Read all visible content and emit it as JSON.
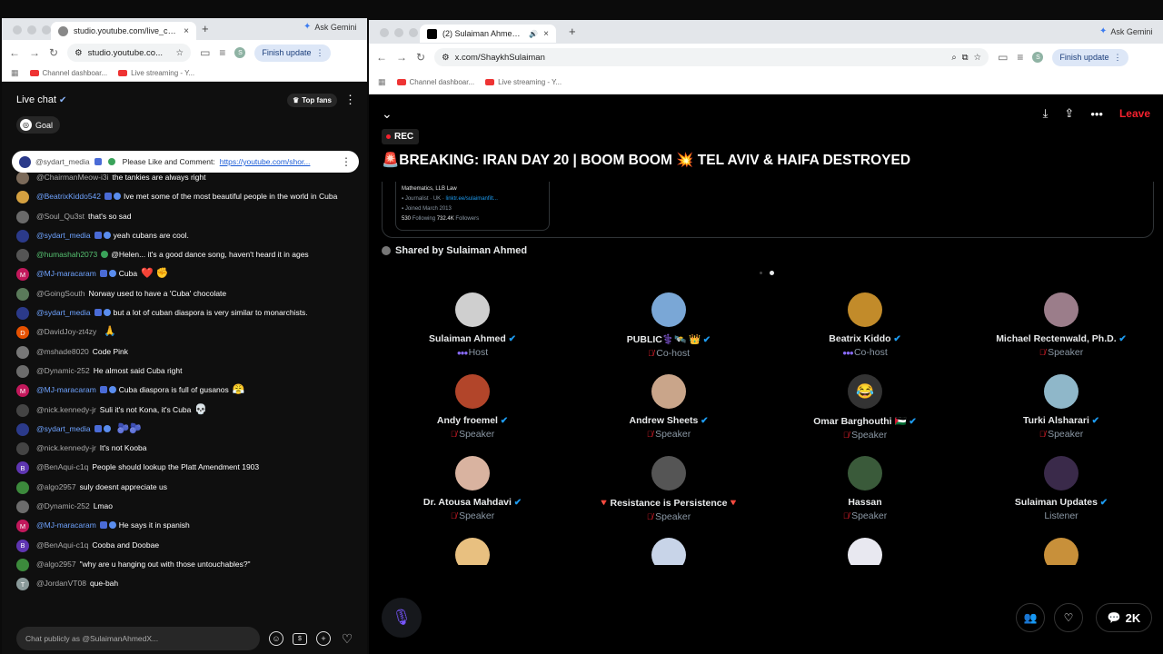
{
  "left_browser": {
    "tab_title": "studio.youtube.com/live_chat",
    "tab_close": "×",
    "new_tab": "+",
    "gemini": "Ask Gemini",
    "url": "studio.youtube.co...",
    "profile": "S",
    "finish_update": "Finish update",
    "bookmarks": [
      "Channel dashboar...",
      "Live streaming - Y..."
    ]
  },
  "right_browser": {
    "tab_title": "(2) Sulaiman Ahmed (@S",
    "tab_close": "×",
    "new_tab": "+",
    "gemini": "Ask Gemini",
    "url": "x.com/ShaykhSulaiman",
    "profile": "S",
    "finish_update": "Finish update",
    "bookmarks": [
      "Channel dashboar...",
      "Live streaming - Y..."
    ]
  },
  "chat": {
    "title": "Live chat",
    "top_fans": "Top fans",
    "goal": "Goal",
    "pinned": {
      "user": "@sydart_media",
      "text": "Please Like and Comment:",
      "link": "https://youtube.com/shor..."
    },
    "placeholder": "Chat publicly as @SulaimanAhmedX...",
    "messages": [
      {
        "user": "@ChairmanMeow-i3i",
        "text": "the tankies are always right",
        "color": "#7b6a5a",
        "kind": "plain",
        "initial": ""
      },
      {
        "user": "@BeatrixKiddo542",
        "text": "Ive met some of the most beautiful people in the world in Cuba",
        "color": "#d4a040",
        "kind": "member",
        "initial": ""
      },
      {
        "user": "@Soul_Qu3st",
        "text": "that's so sad",
        "color": "#6a6a6a",
        "kind": "plain",
        "initial": ""
      },
      {
        "user": "@sydart_media",
        "text": "yeah cubans are cool.",
        "color": "#2b3a8a",
        "kind": "member",
        "initial": ""
      },
      {
        "user": "@humashah2073",
        "text": "@Helen... it's a good dance song, haven't heard it in ages",
        "color": "#555",
        "kind": "green",
        "initial": ""
      },
      {
        "user": "@MJ-maracaram",
        "text": "Cuba",
        "color": "#c2185b",
        "kind": "member",
        "initial": "M",
        "emoji": "❤️ ✊"
      },
      {
        "user": "@GoingSouth",
        "text": "Norway used to have a 'Cuba' chocolate",
        "color": "#5a7a5a",
        "kind": "plain",
        "initial": ""
      },
      {
        "user": "@sydart_media",
        "text": "but a lot of cuban diaspora is very similar to monarchists.",
        "color": "#2b3a8a",
        "kind": "member",
        "initial": ""
      },
      {
        "user": "@DavidJoy-zt4zy",
        "text": "",
        "color": "#e65100",
        "kind": "plain",
        "initial": "D",
        "emoji": "🙏"
      },
      {
        "user": "@mshade8020",
        "text": "Code Pink",
        "color": "#777",
        "kind": "plain",
        "initial": ""
      },
      {
        "user": "@Dynamic-252",
        "text": "He almost said Cuba right",
        "color": "#6c6c6c",
        "kind": "plain",
        "initial": ""
      },
      {
        "user": "@MJ-maracaram",
        "text": "Cuba diaspora is full of gusanos",
        "color": "#c2185b",
        "kind": "member",
        "initial": "M",
        "emoji": "😤"
      },
      {
        "user": "@nick.kennedy-jr",
        "text": "Suli it's not Kona, it's Cuba",
        "color": "#444",
        "kind": "plain",
        "initial": "",
        "emoji": "💀"
      },
      {
        "user": "@sydart_media",
        "text": "",
        "color": "#2b3a8a",
        "kind": "member",
        "initial": "",
        "emoji": "🫐🫐"
      },
      {
        "user": "@nick.kennedy-jr",
        "text": "It's not Kooba",
        "color": "#444",
        "kind": "plain",
        "initial": ""
      },
      {
        "user": "@BenAqui-c1q",
        "text": "People should lookup the Platt Amendment 1903",
        "color": "#5e35b1",
        "kind": "plain",
        "initial": "B"
      },
      {
        "user": "@algo2957",
        "text": "suly doesnt appreciate us",
        "color": "#3c8a3c",
        "kind": "plain",
        "initial": ""
      },
      {
        "user": "@Dynamic-252",
        "text": "Lmao",
        "color": "#6c6c6c",
        "kind": "plain",
        "initial": ""
      },
      {
        "user": "@MJ-maracaram",
        "text": "He says it in spanish",
        "color": "#c2185b",
        "kind": "member",
        "initial": "M"
      },
      {
        "user": "@BenAqui-c1q",
        "text": "Cooba and Doobae",
        "color": "#5e35b1",
        "kind": "plain",
        "initial": "B"
      },
      {
        "user": "@algo2957",
        "text": "\"why are u hanging out with those untouchables?\"",
        "color": "#3c8a3c",
        "kind": "plain",
        "initial": ""
      },
      {
        "user": "@JordanVT08",
        "text": "que-bah",
        "color": "#8a9a9a",
        "kind": "plain",
        "initial": "T"
      }
    ]
  },
  "space": {
    "leave": "Leave",
    "rec": "REC",
    "title": "🚨BREAKING: IRAN DAY 20 | BOOM BOOM 💥 TEL AVIV & HAIFA DESTROYED",
    "card_lines": [
      "Mathematics, LLB Law",
      "Journalist",
      "UK",
      "linktr.ee/sulaimanfilt...",
      "Joined March 2013",
      "530",
      "Following",
      "732.4K",
      "Followers"
    ],
    "shared_by": "Shared by Sulaiman Ahmed",
    "comments": "2K",
    "participants": [
      {
        "name": "Sulaiman Ahmed",
        "role": "Host",
        "role_kind": "host",
        "verified": true,
        "color": "#cfcfcf",
        "emoji": ""
      },
      {
        "name": "PUBLIC⚕️🛰️ 👑",
        "role": "Co-host",
        "role_kind": "muted",
        "verified": true,
        "color": "#7aa7d6",
        "emoji": ""
      },
      {
        "name": "Beatrix Kiddo",
        "role": "Co-host",
        "role_kind": "host",
        "verified": true,
        "color": "#c28b2a",
        "emoji": ""
      },
      {
        "name": "Michael Rectenwald, Ph.D.",
        "role": "Speaker",
        "role_kind": "muted",
        "verified": true,
        "color": "#9b7d8a",
        "emoji": ""
      },
      {
        "name": "Andy froemel",
        "role": "Speaker",
        "role_kind": "muted",
        "verified": true,
        "color": "#b2452a",
        "emoji": ""
      },
      {
        "name": "Andrew Sheets",
        "role": "Speaker",
        "role_kind": "muted",
        "verified": true,
        "color": "#c9a58a",
        "emoji": ""
      },
      {
        "name": "Omar Barghouthi 🇵🇸",
        "role": "Speaker",
        "role_kind": "muted",
        "verified": true,
        "color": "#333",
        "emoji": "😂"
      },
      {
        "name": "Turki Alsharari",
        "role": "Speaker",
        "role_kind": "muted",
        "verified": true,
        "color": "#8fb7c9",
        "emoji": ""
      },
      {
        "name": "Dr. Atousa Mahdavi",
        "role": "Speaker",
        "role_kind": "muted",
        "verified": true,
        "color": "#d9b3a0",
        "emoji": ""
      },
      {
        "name": "🔻Resistance is Persistence🔻",
        "role": "Speaker",
        "role_kind": "muted",
        "verified": false,
        "color": "#555",
        "emoji": ""
      },
      {
        "name": "Hassan",
        "role": "Speaker",
        "role_kind": "muted",
        "verified": false,
        "color": "#3a5a3a",
        "emoji": ""
      },
      {
        "name": "Sulaiman Updates",
        "role": "Listener",
        "role_kind": "plain",
        "verified": true,
        "color": "#3a2a4a",
        "emoji": ""
      },
      {
        "name": "",
        "role": "",
        "role_kind": "plain",
        "verified": false,
        "color": "#e8c080",
        "emoji": ""
      },
      {
        "name": "",
        "role": "",
        "role_kind": "plain",
        "verified": false,
        "color": "#c8d4e8",
        "emoji": ""
      },
      {
        "name": "",
        "role": "",
        "role_kind": "plain",
        "verified": false,
        "color": "#e8e8f0",
        "emoji": ""
      },
      {
        "name": "",
        "role": "",
        "role_kind": "plain",
        "verified": false,
        "color": "#c8903a",
        "emoji": ""
      }
    ]
  }
}
